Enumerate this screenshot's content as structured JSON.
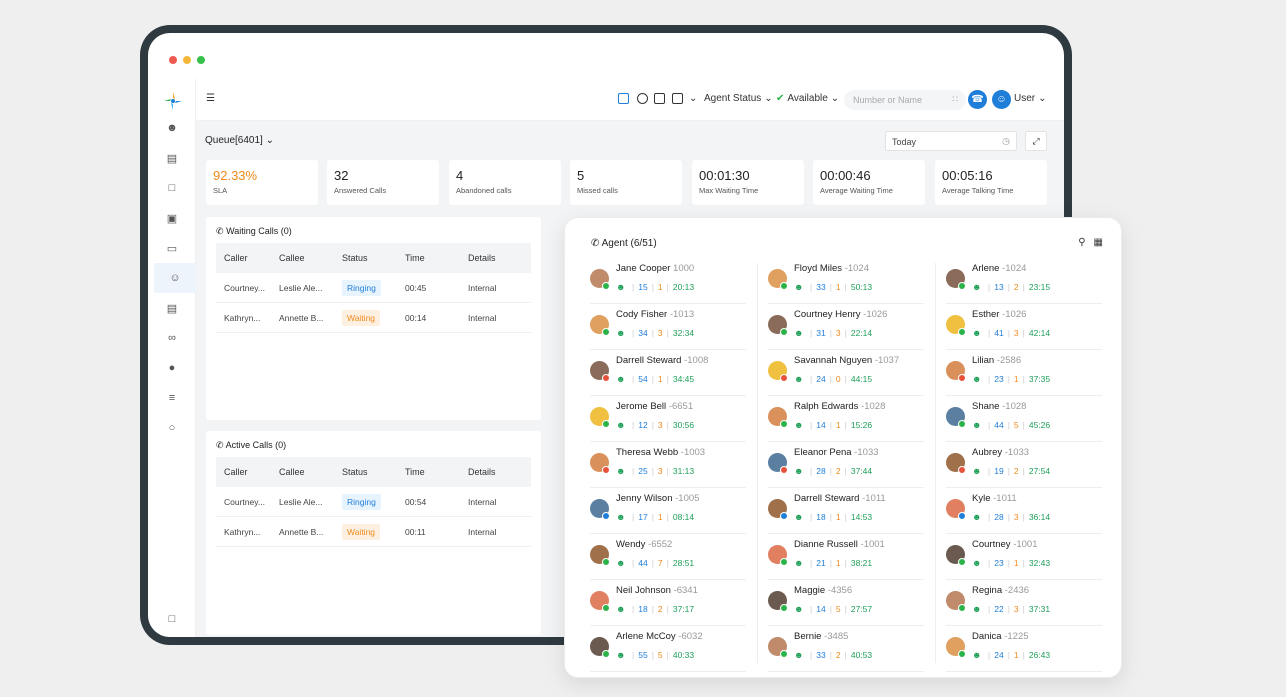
{
  "colors": {
    "accent": "#1f7ed8",
    "ringing": "#1f7ed8",
    "waiting": "#f08a1d",
    "sla": "#f08a1d",
    "online": "#2bb34a",
    "busy": "#e8513a",
    "away": "#f0a41d"
  },
  "topbar": {
    "agent_status_label": "Agent Status",
    "available_label": "Available",
    "search_placeholder": "Number or Name",
    "user_label": "User"
  },
  "main": {
    "queue_label": "Queue[6401]",
    "date_value": "Today"
  },
  "stats": [
    {
      "value": "92.33%",
      "label": "SLA"
    },
    {
      "value": "32",
      "label": "Answered Calls"
    },
    {
      "value": "4",
      "label": "Abandoned calls"
    },
    {
      "value": "5",
      "label": "Missed calls"
    },
    {
      "value": "00:01:30",
      "label": "Max Waiting Time"
    },
    {
      "value": "00:00:46",
      "label": "Average Waiting Time"
    },
    {
      "value": "00:05:16",
      "label": "Average Talking Time"
    }
  ],
  "waiting_calls": {
    "title": "Waiting Calls (0)",
    "headers": [
      "Caller",
      "Callee",
      "Status",
      "Time",
      "Details"
    ],
    "rows": [
      [
        "Courtney...",
        "Leslie Ale...",
        "Ringing",
        "00:45",
        "Internal"
      ],
      [
        "Kathryn...",
        "Annette B...",
        "Waiting",
        "00:14",
        "Internal"
      ]
    ]
  },
  "active_calls": {
    "title": "Active Calls (0)",
    "headers": [
      "Caller",
      "Callee",
      "Status",
      "Time",
      "Details"
    ],
    "rows": [
      [
        "Courtney...",
        "Leslie Ale...",
        "Ringing",
        "00:54",
        "Internal"
      ],
      [
        "Kathryn...",
        "Annette B...",
        "Waiting",
        "00:11",
        "Internal"
      ]
    ]
  },
  "agents": {
    "title": "Agent (6/51)",
    "columns": [
      [
        {
          "name": "Jane Cooper",
          "ext": "1000",
          "a": "15",
          "b": "1",
          "t": "20:13"
        },
        {
          "name": "Cody Fisher",
          "ext": "-1013",
          "a": "34",
          "b": "3",
          "t": "32:34"
        },
        {
          "name": "Darrell Steward",
          "ext": "-1008",
          "a": "54",
          "b": "1",
          "t": "34:45"
        },
        {
          "name": "Jerome Bell",
          "ext": "-6651",
          "a": "12",
          "b": "3",
          "t": "30:56"
        },
        {
          "name": "Theresa Webb",
          "ext": "-1003",
          "a": "25",
          "b": "3",
          "t": "31:13"
        },
        {
          "name": "Jenny Wilson",
          "ext": "-1005",
          "a": "17",
          "b": "1",
          "t": "08:14"
        },
        {
          "name": "Wendy",
          "ext": "-6552",
          "a": "44",
          "b": "7",
          "t": "28:51"
        },
        {
          "name": "Neil Johnson",
          "ext": "-6341",
          "a": "18",
          "b": "2",
          "t": "37:17"
        },
        {
          "name": "Arlene McCoy",
          "ext": "-6032",
          "a": "55",
          "b": "5",
          "t": "40:33"
        }
      ],
      [
        {
          "name": "Floyd Miles",
          "ext": "-1024",
          "a": "33",
          "b": "1",
          "t": "50:13"
        },
        {
          "name": "Courtney Henry",
          "ext": "-1026",
          "a": "31",
          "b": "3",
          "t": "22:14"
        },
        {
          "name": "Savannah Nguyen",
          "ext": "-1037",
          "a": "24",
          "b": "0",
          "t": "44:15"
        },
        {
          "name": "Ralph Edwards",
          "ext": "-1028",
          "a": "14",
          "b": "1",
          "t": "15:26"
        },
        {
          "name": "Eleanor Pena",
          "ext": "-1033",
          "a": "28",
          "b": "2",
          "t": "37:44"
        },
        {
          "name": "Darrell Steward",
          "ext": "-1011",
          "a": "18",
          "b": "1",
          "t": "14:53"
        },
        {
          "name": "Dianne Russell",
          "ext": "-1001",
          "a": "21",
          "b": "1",
          "t": "38:21"
        },
        {
          "name": "Maggie",
          "ext": "-4356",
          "a": "14",
          "b": "5",
          "t": "27:57"
        },
        {
          "name": "Bernie",
          "ext": "-3485",
          "a": "33",
          "b": "2",
          "t": "40:53"
        }
      ],
      [
        {
          "name": "Arlene",
          "ext": "-1024",
          "a": "13",
          "b": "2",
          "t": "23:15"
        },
        {
          "name": "Esther",
          "ext": "-1026",
          "a": "41",
          "b": "3",
          "t": "42:14"
        },
        {
          "name": "Lilian",
          "ext": "-2586",
          "a": "23",
          "b": "1",
          "t": "37:35"
        },
        {
          "name": "Shane",
          "ext": "-1028",
          "a": "44",
          "b": "5",
          "t": "45:26"
        },
        {
          "name": "Aubrey",
          "ext": "-1033",
          "a": "19",
          "b": "2",
          "t": "27:54"
        },
        {
          "name": "Kyle",
          "ext": "-1011",
          "a": "28",
          "b": "3",
          "t": "36:14"
        },
        {
          "name": "Courtney",
          "ext": "-1001",
          "a": "23",
          "b": "1",
          "t": "32:43"
        },
        {
          "name": "Regina",
          "ext": "-2436",
          "a": "22",
          "b": "3",
          "t": "37:31"
        },
        {
          "name": "Danica",
          "ext": "-1225",
          "a": "24",
          "b": "1",
          "t": "26:43"
        }
      ]
    ]
  }
}
